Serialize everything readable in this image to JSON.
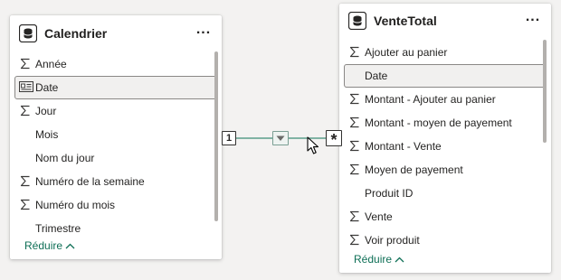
{
  "tables": {
    "left": {
      "title": "Calendrier",
      "icon": "table-icon",
      "more": "...",
      "fields": [
        {
          "label": "Année",
          "icon": "sigma"
        },
        {
          "label": "Date",
          "icon": "calendar-hierarchy",
          "selected": true
        },
        {
          "label": "Jour",
          "icon": "sigma"
        },
        {
          "label": "Mois",
          "icon": ""
        },
        {
          "label": "Nom du jour",
          "icon": ""
        },
        {
          "label": "Numéro de la semaine",
          "icon": "sigma"
        },
        {
          "label": "Numéro du mois",
          "icon": "sigma"
        },
        {
          "label": "Trimestre",
          "icon": ""
        }
      ],
      "collapse_label": "Réduire"
    },
    "right": {
      "title": "VenteTotal",
      "icon": "table-icon",
      "more": "...",
      "fields": [
        {
          "label": "Ajouter au panier",
          "icon": "sigma"
        },
        {
          "label": "Date",
          "icon": "",
          "selected": true
        },
        {
          "label": "Montant - Ajouter au panier",
          "icon": "sigma"
        },
        {
          "label": "Montant - moyen de payement",
          "icon": "sigma"
        },
        {
          "label": "Montant - Vente",
          "icon": "sigma"
        },
        {
          "label": "Moyen de payement",
          "icon": "sigma"
        },
        {
          "label": "Produit ID",
          "icon": ""
        },
        {
          "label": "Vente",
          "icon": "sigma"
        },
        {
          "label": "Voir produit",
          "icon": "sigma"
        }
      ],
      "collapse_label": "Réduire"
    }
  },
  "relationship": {
    "from_cardinality": "1",
    "to_cardinality": "*",
    "line_color": "#5b9e8a",
    "filter_direction": "single"
  },
  "colors": {
    "accent": "#0e6f56",
    "background": "#f3f2f1",
    "selected_bg": "#f1f0ef"
  }
}
